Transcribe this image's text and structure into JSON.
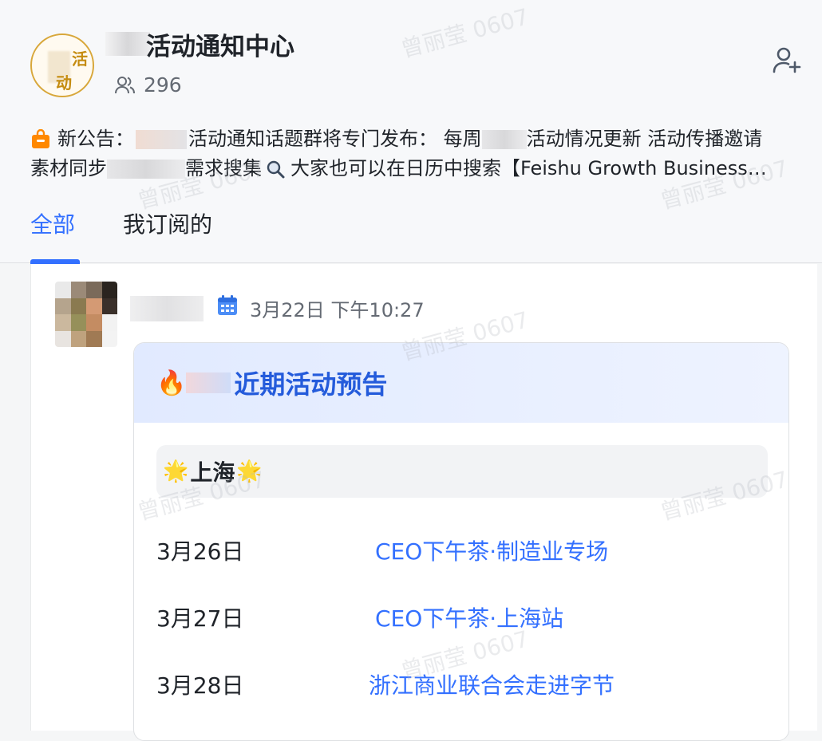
{
  "header": {
    "group_avatar_chars": [
      "活",
      "动"
    ],
    "group_title": "活动通知中心",
    "member_count": "296",
    "add_member_icon": "add-user-icon"
  },
  "notice": {
    "icon": "notice-bag-icon",
    "prefix": "新公告：",
    "line1_a": "活动通知话题群将专门发布：  每周",
    "line1_b": "活动情况更新 活动传播邀请",
    "line2_a": "素材同步",
    "line2_b": "需求搜集",
    "line2_search_icon": "search-icon",
    "line2_c": "大家也可以在日历中搜索【Feishu Growth Business…"
  },
  "tabs": [
    {
      "label": "全部",
      "active": true
    },
    {
      "label": "我订阅的",
      "active": false
    }
  ],
  "post": {
    "calendar_icon": "calendar-icon",
    "time": "3月22日 下午10:27",
    "card": {
      "fire_icon": "🔥",
      "title": "近期活动预告",
      "city": "上海",
      "city_star": "🌟",
      "events": [
        {
          "date": "3月26日",
          "name": "CEO下午茶·制造业专场"
        },
        {
          "date": "3月27日",
          "name": "CEO下午茶·上海站"
        },
        {
          "date": "3月28日",
          "name": "浙江商业联合会走进字节"
        }
      ]
    }
  },
  "watermark": "曾丽莹 0607",
  "colors": {
    "accent": "#3370ff",
    "card_title": "#245bdb",
    "avatar_border": "#d8a73a"
  }
}
